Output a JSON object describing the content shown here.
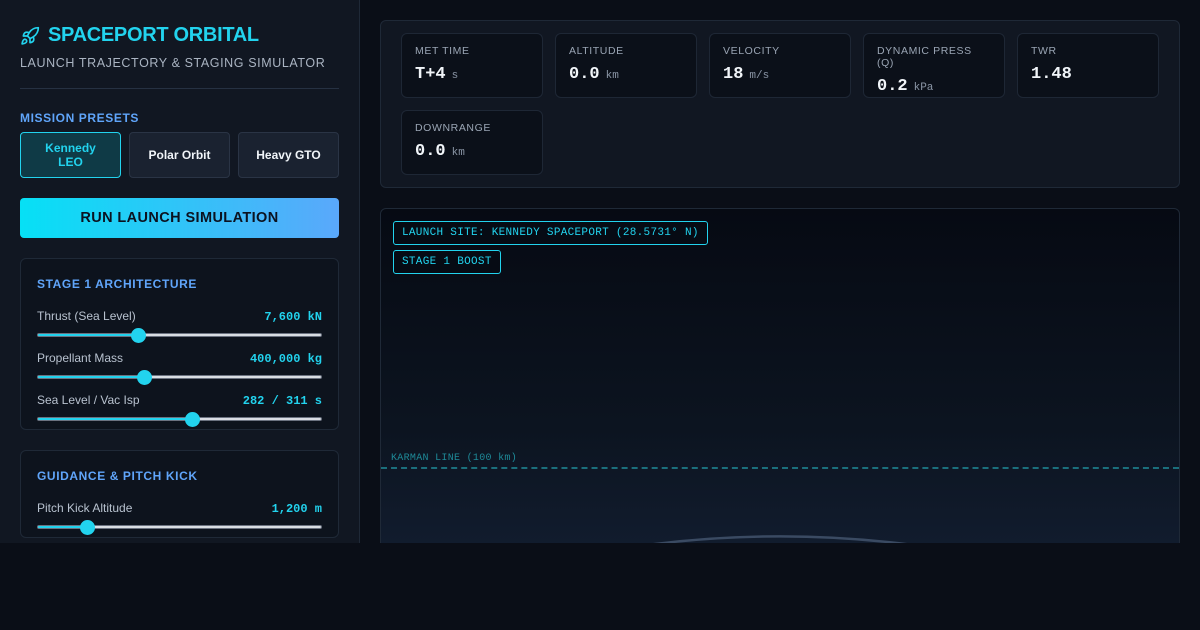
{
  "brand": {
    "title": "SPACEPORT ORBITAL",
    "subtitle": "LAUNCH TRAJECTORY & STAGING SIMULATOR",
    "icon": "rocket-icon"
  },
  "presets": {
    "label": "MISSION PRESETS",
    "items": [
      {
        "label": "Kennedy LEO",
        "active": true
      },
      {
        "label": "Polar Orbit",
        "active": false
      },
      {
        "label": "Heavy GTO",
        "active": false
      }
    ]
  },
  "run_button": {
    "label": "RUN LAUNCH SIMULATION"
  },
  "stage1": {
    "title": "STAGE 1 ARCHITECTURE",
    "sliders": [
      {
        "label": "Thrust (Sea Level)",
        "value": "7,600 kN",
        "fraction": 0.355
      },
      {
        "label": "Propellant Mass",
        "value": "400,000 kg",
        "fraction": 0.375
      },
      {
        "label": "Sea Level / Vac Isp",
        "value": "282 / 311 s",
        "fraction": 0.545
      }
    ]
  },
  "guidance": {
    "title": "GUIDANCE & PITCH KICK",
    "sliders": [
      {
        "label": "Pitch Kick Altitude",
        "value": "1,200 m",
        "fraction": 0.175
      }
    ]
  },
  "telemetry": [
    {
      "label": "MET TIME",
      "value": "T+4",
      "unit": "s"
    },
    {
      "label": "ALTITUDE",
      "value": "0.0",
      "unit": "km"
    },
    {
      "label": "VELOCITY",
      "value": "18",
      "unit": "m/s"
    },
    {
      "label": "DYNAMIC PRESS (Q)",
      "value": "0.2",
      "unit": "kPa"
    },
    {
      "label": "TWR",
      "value": "1.48",
      "unit": ""
    },
    {
      "label": "DOWNRANGE",
      "value": "0.0",
      "unit": "km"
    }
  ],
  "viz": {
    "site_tag": "LAUNCH SITE: KENNEDY SPACEPORT (28.5731° N)",
    "stage_tag": "STAGE 1 BOOST",
    "karman_label": "KARMAN LINE (100 km)"
  },
  "colors": {
    "accent": "#22d3ee",
    "accent_blue": "#60a5fa",
    "background": "#0a0e17",
    "panel": "#111722"
  }
}
